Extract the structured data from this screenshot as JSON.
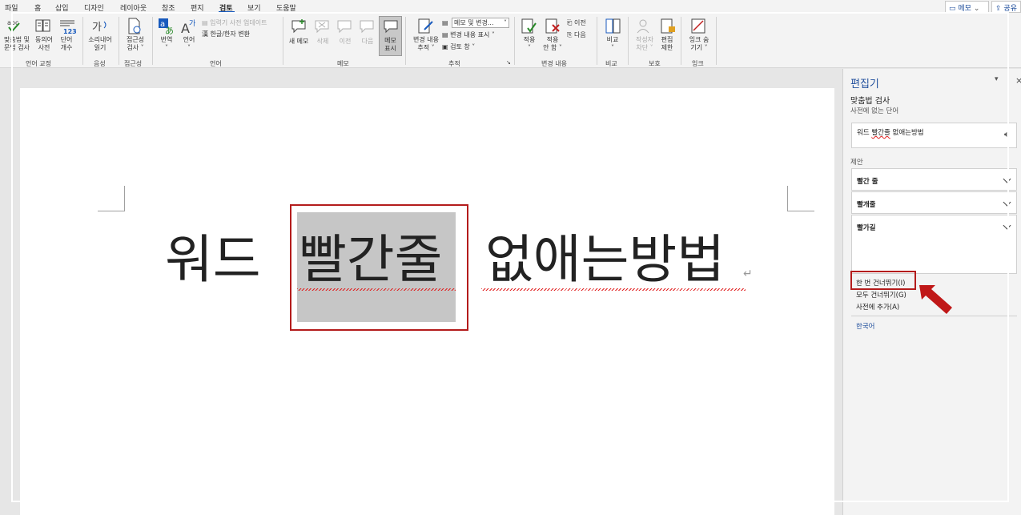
{
  "menu": {
    "tabs": [
      "파일",
      "홈",
      "삽입",
      "디자인",
      "레이아웃",
      "참조",
      "편지",
      "검토",
      "보기",
      "도움말"
    ],
    "active_tab": "검토",
    "memo_button": "메모",
    "share_button": "공유"
  },
  "ribbon": {
    "proofing": {
      "spelling": [
        "맞춤법 및",
        "문법 검사"
      ],
      "thesaurus": [
        "동의어",
        "사전"
      ],
      "word_count": [
        "단어",
        "개수"
      ],
      "group": "언어 교정"
    },
    "speech": {
      "read_aloud": [
        "소리내어",
        "읽기"
      ],
      "group": "음성"
    },
    "accessibility": {
      "check": [
        "접근성",
        "검사 ˅"
      ],
      "group": "접근성"
    },
    "language": {
      "translate": [
        "번역",
        "˅"
      ],
      "language": [
        "언어",
        "˅"
      ],
      "update_ime": "입력기 사전 업데이트",
      "hanja": "한글/한자 변환",
      "group": "언어"
    },
    "comments": {
      "new": "새 메모",
      "delete": "삭제",
      "previous": "이전",
      "next": "다음",
      "show": [
        "메모",
        "표시"
      ],
      "group": "메모"
    },
    "tracking": {
      "track_changes": [
        "변경 내용",
        "추적 ˅"
      ],
      "markup_select": "메모 및 변경...",
      "show_markup": "변경 내용 표시 ˅",
      "reviewing_pane": "검토 창 ˅",
      "group": "추적"
    },
    "changes": {
      "accept": [
        "적용",
        "˅"
      ],
      "reject": [
        "적용",
        "안 함 ˅"
      ],
      "previous": "이전",
      "next": "다음",
      "group": "변경 내용"
    },
    "compare": {
      "compare": [
        "비교",
        "˅"
      ],
      "group": "비교"
    },
    "protect": {
      "block_authors": [
        "작성자",
        "차단 ˅"
      ],
      "restrict_editing": [
        "편집",
        "제한"
      ],
      "group": "보호"
    },
    "ink": {
      "hide_ink": [
        "잉크 숨",
        "기기 ˅"
      ],
      "group": "잉크"
    }
  },
  "document": {
    "word1": "워드",
    "word2": "빨간줄",
    "word3": "없애는방법"
  },
  "editor": {
    "title": "편집기",
    "section": "맞춤법 검사",
    "subtitle": "사전에 없는 단어",
    "context_before": "워드 ",
    "context_error": "빨간줄",
    "context_after": " 없애는방법",
    "suggestions_label": "제안",
    "suggestions": [
      "빨간 줄",
      "빨개줄",
      "빨가길"
    ],
    "ignore_once": "한 번 건너뛰기(I)",
    "ignore_all": "모두 건너뛰기(G)",
    "add_to_dictionary": "사전에 추가(A)",
    "language": "한국어"
  },
  "colors": {
    "accent": "#185abd",
    "highlight_box": "#b41c1c",
    "selection": "#c6c6c6"
  }
}
